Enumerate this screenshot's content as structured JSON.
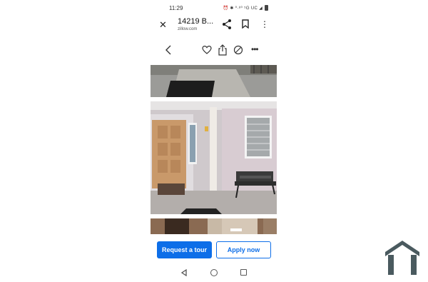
{
  "status_bar": {
    "time": "11:29",
    "indicators": "⏰ ✱ ⁰·⁸⁰ ⁵G UC ◢"
  },
  "tab_bar": {
    "title": "14219 B...",
    "url": "zillow.com",
    "icons": [
      "close-icon",
      "share-icon",
      "bookmark-icon",
      "more-vert-icon"
    ]
  },
  "page_toolbar": {
    "icons": [
      "back-chevron-icon",
      "heart-icon",
      "upload-share-icon",
      "hide-icon",
      "more-horiz-icon"
    ]
  },
  "photos": [
    {
      "name": "driveway-photo"
    },
    {
      "name": "front-porch-photo"
    },
    {
      "name": "interior-photo"
    }
  ],
  "cta": {
    "request_tour": "Request a tour",
    "apply_now": "Apply now"
  },
  "colors": {
    "accent": "#0d6ee8",
    "logo": "#4a5a5f"
  }
}
